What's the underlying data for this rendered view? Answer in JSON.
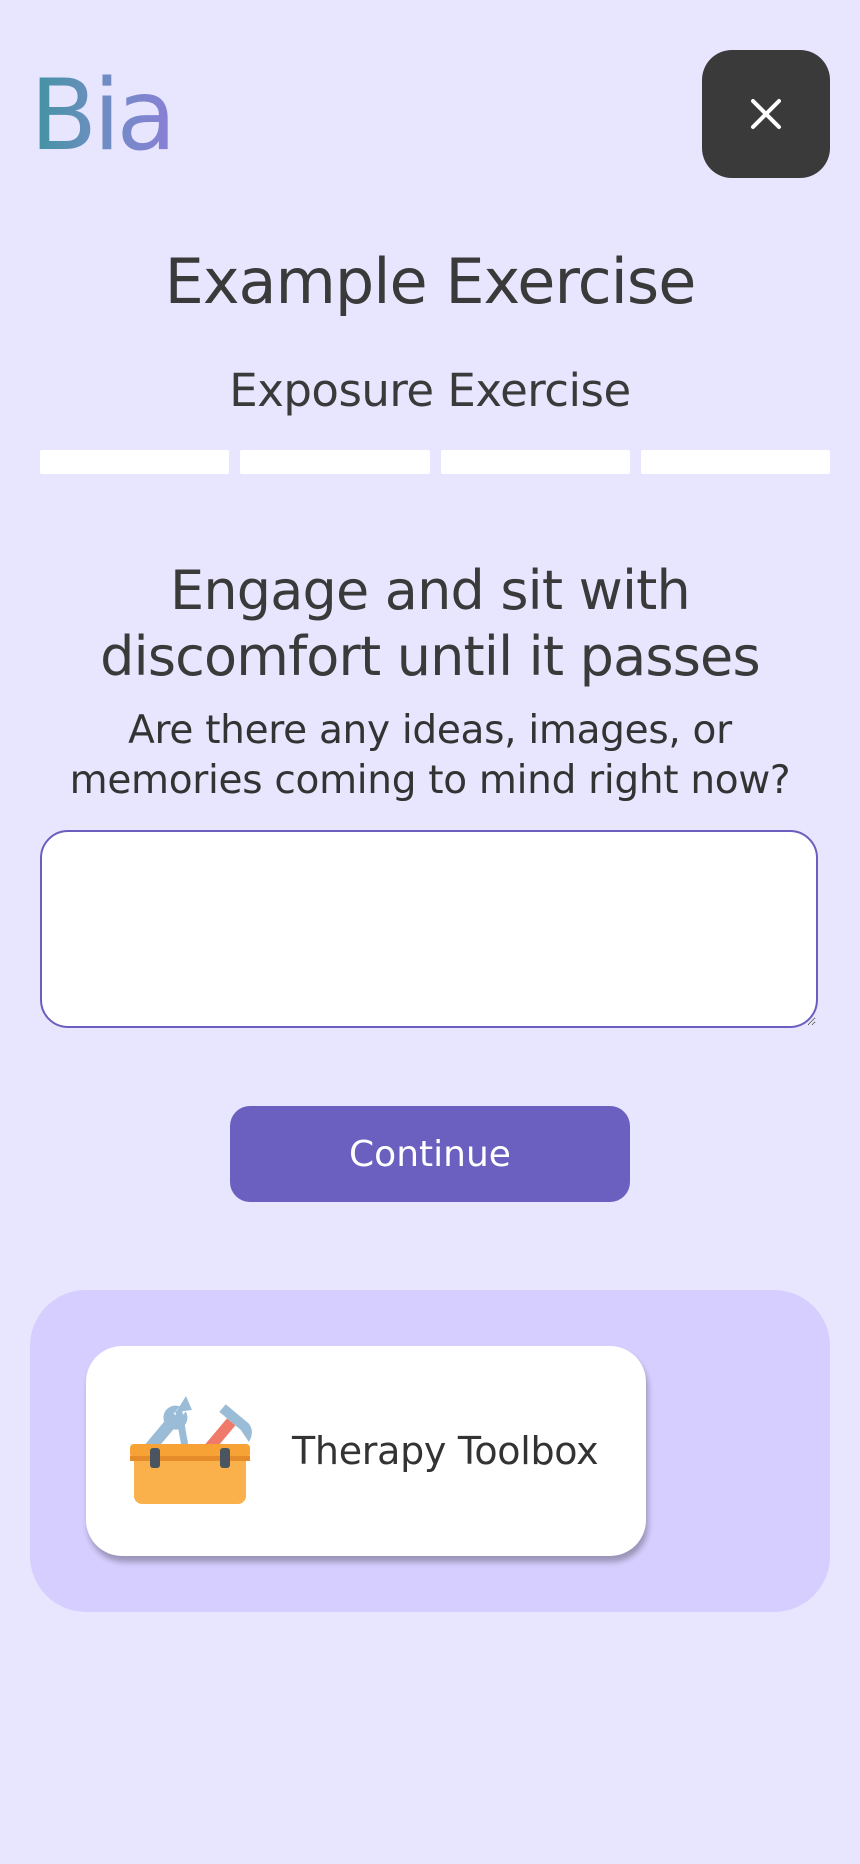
{
  "app": {
    "logo_text": "Bia"
  },
  "header": {
    "close_label": "×"
  },
  "exercise": {
    "title": "Example Exercise",
    "subtitle": "Exposure Exercise",
    "progress": {
      "total_steps": 4,
      "completed_steps": 0
    },
    "step_heading": "Engage and sit with discomfort until it passes",
    "question": "Are there any ideas, images, or memories coming to mind right now?",
    "answer": {
      "value": "",
      "placeholder": ""
    },
    "continue_label": "Continue"
  },
  "toolbox": {
    "label": "Therapy Toolbox",
    "icon": "toolbox-icon"
  },
  "colors": {
    "background": "#e8e5fe",
    "accent": "#6b5fbf",
    "panel": "#d5cefe",
    "close_button": "#3a3a3a"
  }
}
